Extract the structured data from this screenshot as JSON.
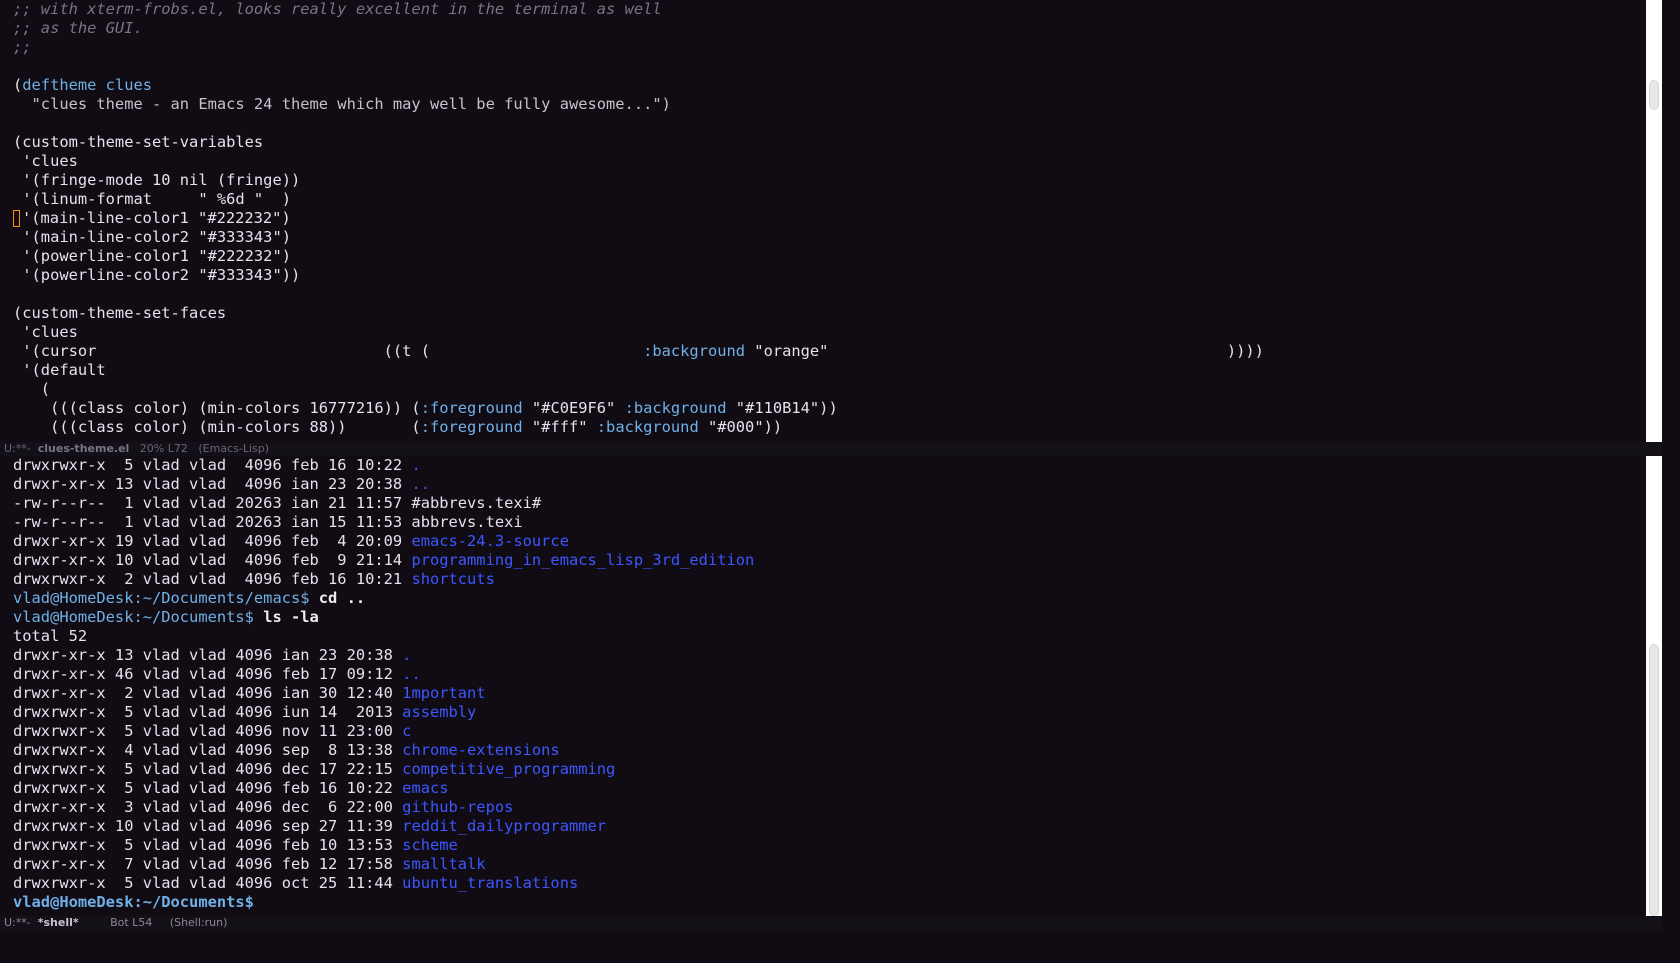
{
  "editor": {
    "lines": [
      {
        "cls": "comment",
        "text": ";; with xterm-frobs.el, looks really excellent in the terminal as well"
      },
      {
        "cls": "comment",
        "text": ";; as the GUI."
      },
      {
        "cls": "comment",
        "text": ";;"
      },
      {
        "cls": "",
        "text": ""
      },
      {
        "parts": [
          {
            "cls": "",
            "text": "("
          },
          {
            "cls": "kw",
            "text": "deftheme clues"
          }
        ]
      },
      {
        "parts": [
          {
            "cls": "str",
            "text": "  \"clues theme - an Emacs 24 theme which may well be fully awesome...\")"
          }
        ]
      },
      {
        "cls": "",
        "text": ""
      },
      {
        "cls": "",
        "text": "(custom-theme-set-variables"
      },
      {
        "cls": "",
        "text": " 'clues"
      },
      {
        "cls": "",
        "text": " '(fringe-mode 10 nil (fringe))"
      },
      {
        "cls": "",
        "text": " '(linum-format     \" %6d \"  )"
      },
      {
        "cursor": true,
        "cls": "",
        "text": "'(main-line-color1 \"#222232\")"
      },
      {
        "cls": "",
        "text": " '(main-line-color2 \"#333343\")"
      },
      {
        "cls": "",
        "text": " '(powerline-color1 \"#222232\")"
      },
      {
        "cls": "",
        "text": " '(powerline-color2 \"#333343\"))"
      },
      {
        "cls": "",
        "text": ""
      },
      {
        "cls": "",
        "text": "(custom-theme-set-faces"
      },
      {
        "cls": "",
        "text": " 'clues"
      },
      {
        "parts": [
          {
            "cls": "",
            "text": " '(cursor                               ((t (                       "
          },
          {
            "cls": "kw",
            "text": ":background"
          },
          {
            "cls": "",
            "text": " \"orange\"                                           ))))"
          }
        ]
      },
      {
        "cls": "",
        "text": " '(default"
      },
      {
        "cls": "",
        "text": "   ("
      },
      {
        "parts": [
          {
            "cls": "",
            "text": "    (((class color) (min-colors 16777216)) ("
          },
          {
            "cls": "kw",
            "text": ":foreground"
          },
          {
            "cls": "",
            "text": " \"#C0E9F6\" "
          },
          {
            "cls": "kw",
            "text": ":background"
          },
          {
            "cls": "",
            "text": " \"#110B14\"))"
          }
        ]
      },
      {
        "parts": [
          {
            "cls": "",
            "text": "    (((class color) (min-colors 88))       ("
          },
          {
            "cls": "kw",
            "text": ":foreground"
          },
          {
            "cls": "",
            "text": " \"#fff\" "
          },
          {
            "cls": "kw",
            "text": ":background"
          },
          {
            "cls": "",
            "text": " \"#000\"))"
          }
        ]
      }
    ]
  },
  "modeline_top": {
    "status": "U:**-  ",
    "buffer": "clues-theme.el",
    "position": "   20% L72   ",
    "mode": "(Emacs-Lisp)"
  },
  "shell": {
    "lines": [
      {
        "parts": [
          {
            "cls": "",
            "text": "drwxrwxr-x  5 vlad vlad  4096 feb 16 10:22 "
          },
          {
            "cls": "link",
            "text": "."
          }
        ]
      },
      {
        "parts": [
          {
            "cls": "",
            "text": "drwxr-xr-x 13 vlad vlad  4096 ian 23 20:38 "
          },
          {
            "cls": "link",
            "text": ".."
          }
        ]
      },
      {
        "parts": [
          {
            "cls": "",
            "text": "-rw-r--r--  1 vlad vlad 20263 ian 21 11:57 #abbrevs.texi#"
          }
        ]
      },
      {
        "parts": [
          {
            "cls": "",
            "text": "-rw-r--r--  1 vlad vlad 20263 ian 15 11:53 abbrevs.texi"
          }
        ]
      },
      {
        "parts": [
          {
            "cls": "",
            "text": "drwxr-xr-x 19 vlad vlad  4096 feb  4 20:09 "
          },
          {
            "cls": "link",
            "text": "emacs-24.3-source"
          }
        ]
      },
      {
        "parts": [
          {
            "cls": "",
            "text": "drwxr-xr-x 10 vlad vlad  4096 feb  9 21:14 "
          },
          {
            "cls": "link",
            "text": "programming_in_emacs_lisp_3rd_edition"
          }
        ]
      },
      {
        "parts": [
          {
            "cls": "",
            "text": "drwxrwxr-x  2 vlad vlad  4096 feb 16 10:21 "
          },
          {
            "cls": "link",
            "text": "shortcuts"
          }
        ]
      },
      {
        "parts": [
          {
            "cls": "prompt",
            "text": "vlad@HomeDesk:~/Documents/emacs$ "
          },
          {
            "cls": "cmd",
            "text": "cd .."
          }
        ]
      },
      {
        "parts": [
          {
            "cls": "prompt",
            "text": "vlad@HomeDesk:~/Documents$ "
          },
          {
            "cls": "cmd",
            "text": "ls -la"
          }
        ]
      },
      {
        "parts": [
          {
            "cls": "",
            "text": "total 52"
          }
        ]
      },
      {
        "parts": [
          {
            "cls": "",
            "text": "drwxr-xr-x 13 vlad vlad 4096 ian 23 20:38 "
          },
          {
            "cls": "link",
            "text": "."
          }
        ]
      },
      {
        "parts": [
          {
            "cls": "",
            "text": "drwxr-xr-x 46 vlad vlad 4096 feb 17 09:12 "
          },
          {
            "cls": "link",
            "text": ".."
          }
        ]
      },
      {
        "parts": [
          {
            "cls": "",
            "text": "drwxr-xr-x  2 vlad vlad 4096 ian 30 12:40 "
          },
          {
            "cls": "link",
            "text": "1mportant"
          }
        ]
      },
      {
        "parts": [
          {
            "cls": "",
            "text": "drwxrwxr-x  5 vlad vlad 4096 iun 14  2013 "
          },
          {
            "cls": "link",
            "text": "assembly"
          }
        ]
      },
      {
        "parts": [
          {
            "cls": "",
            "text": "drwxrwxr-x  5 vlad vlad 4096 nov 11 23:00 "
          },
          {
            "cls": "link",
            "text": "c"
          }
        ]
      },
      {
        "parts": [
          {
            "cls": "",
            "text": "drwxrwxr-x  4 vlad vlad 4096 sep  8 13:38 "
          },
          {
            "cls": "link",
            "text": "chrome-extensions"
          }
        ]
      },
      {
        "parts": [
          {
            "cls": "",
            "text": "drwxrwxr-x  5 vlad vlad 4096 dec 17 22:15 "
          },
          {
            "cls": "link",
            "text": "competitive_programming"
          }
        ]
      },
      {
        "parts": [
          {
            "cls": "",
            "text": "drwxrwxr-x  5 vlad vlad 4096 feb 16 10:22 "
          },
          {
            "cls": "link",
            "text": "emacs"
          }
        ]
      },
      {
        "parts": [
          {
            "cls": "",
            "text": "drwxr-xr-x  3 vlad vlad 4096 dec  6 22:00 "
          },
          {
            "cls": "link",
            "text": "github-repos"
          }
        ]
      },
      {
        "parts": [
          {
            "cls": "",
            "text": "drwxrwxr-x 10 vlad vlad 4096 sep 27 11:39 "
          },
          {
            "cls": "link",
            "text": "reddit_dailyprogrammer"
          }
        ]
      },
      {
        "parts": [
          {
            "cls": "",
            "text": "drwxrwxr-x  5 vlad vlad 4096 feb 10 13:53 "
          },
          {
            "cls": "link",
            "text": "scheme"
          }
        ]
      },
      {
        "parts": [
          {
            "cls": "",
            "text": "drwxr-xr-x  7 vlad vlad 4096 feb 12 17:58 "
          },
          {
            "cls": "link",
            "text": "smalltalk"
          }
        ]
      },
      {
        "parts": [
          {
            "cls": "",
            "text": "drwxrwxr-x  5 vlad vlad 4096 oct 25 11:44 "
          },
          {
            "cls": "link",
            "text": "ubuntu_translations"
          }
        ]
      },
      {
        "parts": [
          {
            "cls": "prompt-bold",
            "text": "vlad@HomeDesk:~/Documents$"
          }
        ]
      }
    ]
  },
  "modeline_bottom": {
    "status": "U:**-  ",
    "buffer": "*shell*",
    "position": "         Bot L54     ",
    "mode": "(Shell:run)"
  },
  "colors": {
    "background": "#110b14",
    "foreground": "#e6e2ec",
    "keyword": "#6fb1e6",
    "link": "#3c57ff",
    "cursor": "#ff8c00"
  }
}
